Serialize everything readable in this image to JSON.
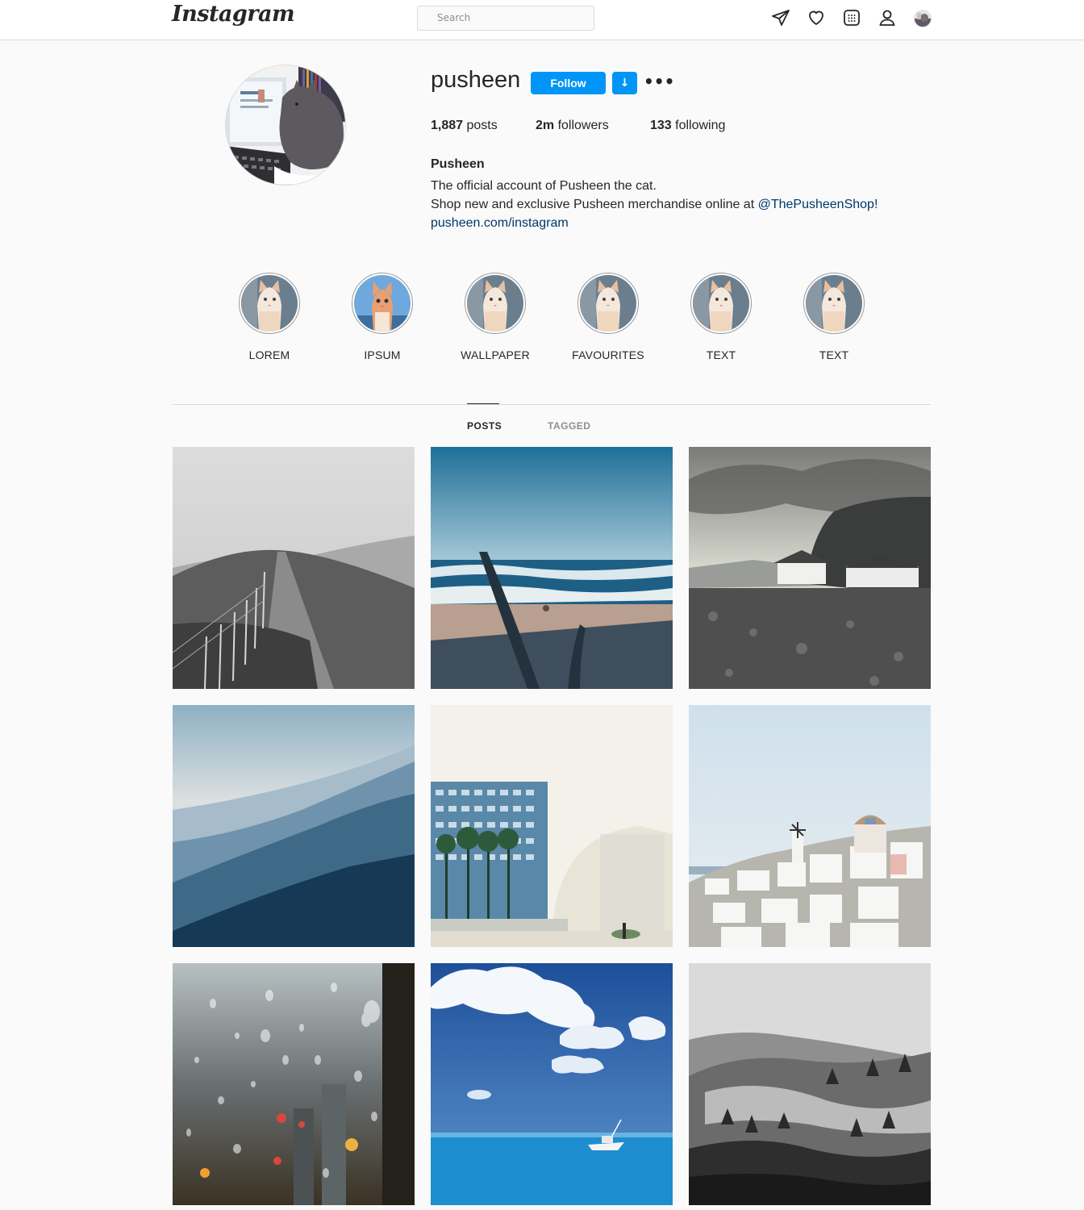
{
  "header": {
    "logo": "Instagram",
    "search_placeholder": "Search",
    "icons": [
      "direct-icon",
      "heart-icon",
      "explore-icon",
      "profile-icon",
      "avatar"
    ]
  },
  "profile": {
    "username": "pusheen",
    "follow_label": "Follow",
    "dropdown_label": "↓",
    "more_label": "•••",
    "stats": {
      "posts_count": "1,887",
      "posts_label": " posts",
      "followers_count": "2m",
      "followers_label": " followers",
      "following_count": "133",
      "following_label": " following"
    },
    "full_name": "Pusheen",
    "bio_line1": "The official account of Pusheen the cat.",
    "bio_line2_prefix": "Shop new and exclusive Pusheen merchandise online at ",
    "bio_line2_mention": "@ThePusheenShop",
    "bio_line2_suffix": "!",
    "website": "pusheen.com/instagram"
  },
  "highlights": [
    {
      "label": "LOREM"
    },
    {
      "label": "IPSUM"
    },
    {
      "label": "WALLPAPER"
    },
    {
      "label": "FAVOURITES"
    },
    {
      "label": "TEXT"
    },
    {
      "label": "TEXT"
    }
  ],
  "tabs": {
    "posts": "POSTS",
    "tagged": "TAGGED"
  },
  "posts": [
    {
      "subject": "hillside path with fence (black and white)"
    },
    {
      "subject": "beach with waves"
    },
    {
      "subject": "coastal cottages under cliff"
    },
    {
      "subject": "misty mountain ridges"
    },
    {
      "subject": "building with palm trees and surfer"
    },
    {
      "subject": "white village with windmill"
    },
    {
      "subject": "raindrops on window with city lights"
    },
    {
      "subject": "boat on blue sea under clouds"
    },
    {
      "subject": "foggy forest (black and white)"
    }
  ],
  "colors": {
    "accent": "#0095f6",
    "link": "#00376b",
    "text": "#262626",
    "muted": "#8e8e8e",
    "border": "#dbdbdb",
    "background": "#fafafa"
  }
}
